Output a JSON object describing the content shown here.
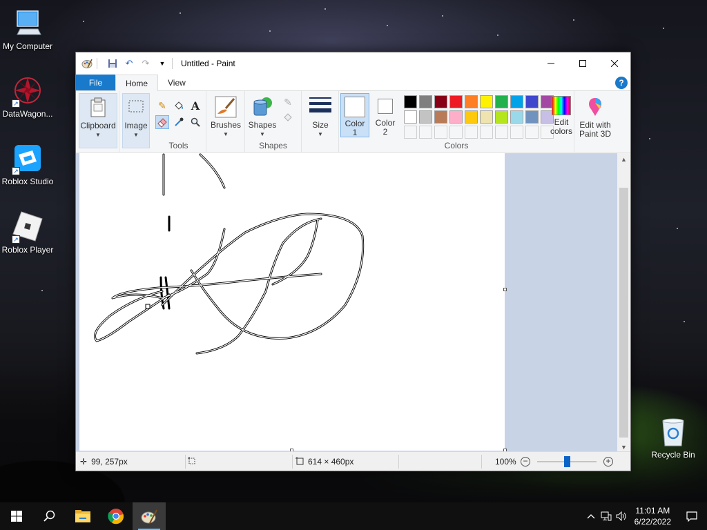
{
  "desktop": {
    "icons": [
      {
        "label": "My Computer",
        "icon": "computer-icon"
      },
      {
        "label": "DataWagon...",
        "icon": "datawagon-icon"
      },
      {
        "label": "Roblox Studio",
        "icon": "roblox-studio-icon"
      },
      {
        "label": "Roblox Player",
        "icon": "roblox-player-icon"
      },
      {
        "label": "Recycle Bin",
        "icon": "recycle-bin-icon"
      }
    ]
  },
  "window": {
    "title": "Untitled - Paint",
    "tabs": {
      "file": "File",
      "home": "Home",
      "view": "View"
    },
    "help": "?"
  },
  "ribbon": {
    "clipboard": "Clipboard",
    "image": "Image",
    "tools_label": "Tools",
    "brushes": "Brushes",
    "shapes_btn": "Shapes",
    "shapes_label": "Shapes",
    "size": "Size",
    "color1": "Color",
    "color1_num": "1",
    "color2": "Color",
    "color2_num": "2",
    "colors_label": "Colors",
    "edit_colors_1": "Edit",
    "edit_colors_2": "colors",
    "edit3d_1": "Edit with",
    "edit3d_2": "Paint 3D",
    "palette_row1": [
      "#000000",
      "#7f7f7f",
      "#880015",
      "#ed1c24",
      "#ff7f27",
      "#fff200",
      "#22b14c",
      "#00a2e8",
      "#3f48cc",
      "#a349a4"
    ],
    "palette_row2": [
      "#ffffff",
      "#c3c3c3",
      "#b97a57",
      "#ffaec9",
      "#ffc90e",
      "#efe4b0",
      "#b5e61d",
      "#99d9ea",
      "#7092be",
      "#c8bfe7"
    ]
  },
  "status": {
    "cursor_pos": "99, 257px",
    "canvas_size": "614 × 460px",
    "zoom": "100%",
    "zoom_level": 0.5
  },
  "taskbar": {
    "time": "11:01 AM",
    "date": "6/22/2022"
  }
}
